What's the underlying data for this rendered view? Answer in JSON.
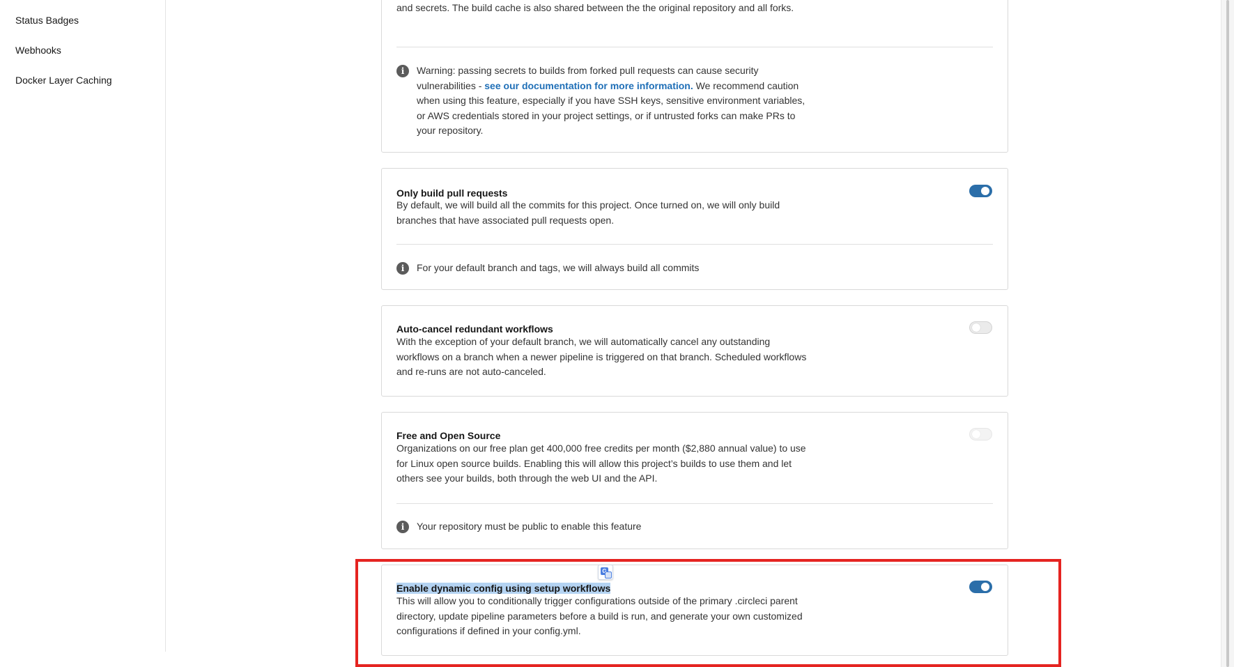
{
  "sidebar": {
    "items": [
      {
        "label": "Status Badges"
      },
      {
        "label": "Webhooks"
      },
      {
        "label": "Docker Layer Caching"
      }
    ]
  },
  "cards": {
    "forked": {
      "desc_tail": "and secrets. The build cache is also shared between the the original repository and all forks.",
      "warning_pre": "Warning: passing secrets to builds from forked pull requests can cause security vulnerabilities - ",
      "warning_link": "see our documentation for more information.",
      "warning_post": " We recommend caution when using this feature, especially if you have SSH keys, sensitive environment variables, or AWS credentials stored in your project settings, or if untrusted forks can make PRs to your repository."
    },
    "only_pr": {
      "title": "Only build pull requests",
      "desc": "By default, we will build all the commits for this project. Once turned on, we will only build branches that have associated pull requests open.",
      "note": "For your default branch and tags, we will always build all commits",
      "enabled": true
    },
    "auto_cancel": {
      "title": "Auto-cancel redundant workflows",
      "desc": "With the exception of your default branch, we will automatically cancel any outstanding workflows on a branch when a newer pipeline is triggered on that branch. Scheduled workflows and re-runs are not auto-canceled.",
      "enabled": false
    },
    "foss": {
      "title": "Free and Open Source",
      "desc": "Organizations on our free plan get 400,000 free credits per month ($2,880 annual value) to use for Linux open source builds. Enabling this will allow this project’s builds to use them and let others see your builds, both through the web UI and the API.",
      "note": "Your repository must be public to enable this feature",
      "enabled": false
    },
    "dynamic_config": {
      "title": "Enable dynamic config using setup workflows",
      "desc": "This will allow you to conditionally trigger configurations outside of the primary .circleci parent directory, update pipeline parameters before a build is run, and generate your own customized configurations if defined in your config.yml.",
      "enabled": true
    }
  },
  "icons": {
    "info": "info-icon",
    "translate": "translate-icon"
  },
  "colors": {
    "toggle_on": "#2b6ea9",
    "link": "#1f6fb7",
    "annotation": "#e52421",
    "selection": "#b4d3f2"
  }
}
